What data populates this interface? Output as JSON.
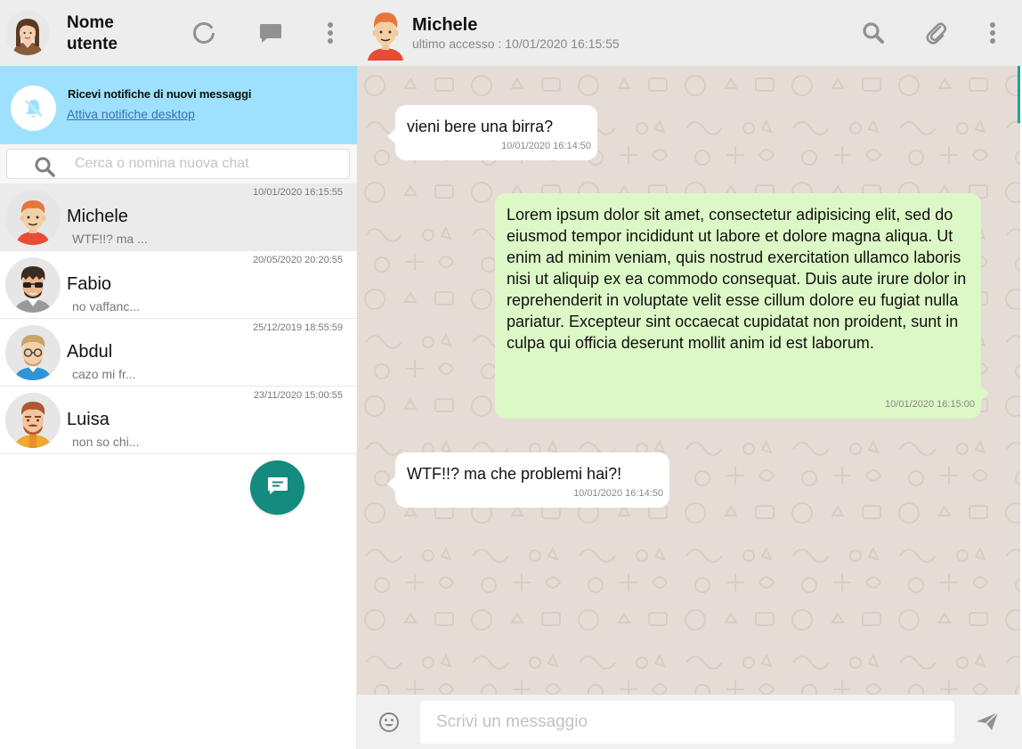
{
  "user": {
    "name": "Nome utente"
  },
  "notification": {
    "title": "Ricevi notifiche di nuovi messaggi",
    "link": "Attiva notifiche desktop"
  },
  "search": {
    "placeholder": "Cerca o nomina nuova chat"
  },
  "chats": [
    {
      "name": "Michele",
      "time": "10/01/2020 16:15:55",
      "last": "WTF!!? ma ...",
      "active": true
    },
    {
      "name": "Fabio",
      "time": "20/05/2020 20:20:55",
      "last": "no vaffanc..."
    },
    {
      "name": "Abdul",
      "time": "25/12/2019 18:55:59",
      "last": "cazo mi fr..."
    },
    {
      "name": "Luisa",
      "time": "23/11/2020 15:00:55",
      "last": "non so chi..."
    }
  ],
  "contact": {
    "name": "Michele",
    "status": "ultimo accesso : 10/01/2020 16:15:55"
  },
  "messages": [
    {
      "type": "received",
      "text": "vieni bere una birra?",
      "time": "10/01/2020 16:14:50"
    },
    {
      "type": "sent",
      "text": "Lorem ipsum dolor sit amet, consectetur adipisicing elit, sed do eiusmod tempor incididunt ut labore et dolore magna aliqua. Ut enim ad minim veniam, quis nostrud exercitation ullamco laboris nisi ut aliquip ex ea commodo consequat. Duis aute irure dolor in reprehenderit in voluptate velit esse cillum dolore eu fugiat nulla pariatur. Excepteur sint occaecat cupidatat non proident, sunt in culpa qui officia deserunt mollit anim id est laborum.",
      "time": "10/01/2020 16:15:00"
    },
    {
      "type": "received",
      "text": "WTF!!? ma che problemi hai?!",
      "time": "10/01/2020 16:14:50"
    }
  ],
  "compose": {
    "placeholder": "Scrivi un messaggio"
  },
  "icons": {
    "status": "status-ring-icon",
    "chat": "chat-icon",
    "menu": "menu-dots-icon",
    "bell_off": "bell-off-icon",
    "search": "search-icon",
    "attach": "paperclip-icon",
    "emoji": "smiley-icon",
    "send": "send-icon",
    "new_chat": "new-chat-icon"
  },
  "colors": {
    "header_bg": "#ededed",
    "notify_bg": "#9de1fe",
    "link": "#3e6fb4",
    "fab": "#138b7e",
    "conversation_bg": "#e5ddd5",
    "sent_bubble": "#dcf8c6",
    "received_bubble": "#ffffff",
    "accent": "#1ba3a0"
  }
}
